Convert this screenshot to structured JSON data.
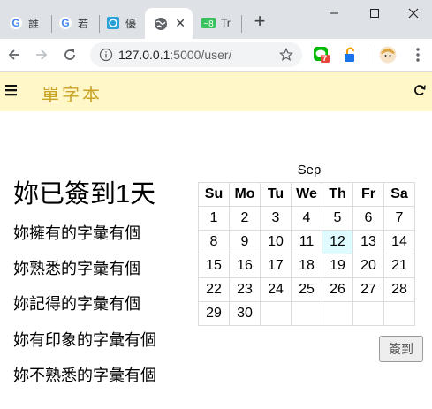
{
  "browser": {
    "tabs": [
      {
        "title": "誰",
        "icon": "google-icon"
      },
      {
        "title": "若",
        "icon": "google-icon"
      },
      {
        "title": "優",
        "icon": "site-icon"
      },
      {
        "title": "",
        "icon": "globe-icon",
        "active": true
      },
      {
        "title": "Tr",
        "icon": "translate-icon"
      }
    ],
    "new_tab": "+",
    "url_host": "127.0.0.1",
    "url_path": ":5000/user/",
    "extension_badge": "7"
  },
  "app": {
    "brand": "單字本",
    "menu_icon": "hamburger-menu-icon",
    "right_icon": "refresh-icon"
  },
  "main": {
    "title": "妳已簽到1天",
    "stats": [
      "妳擁有的字彙有個",
      "妳熟悉的字彙有個",
      "妳記得的字彙有個",
      "妳有印象的字彙有個",
      "妳不熟悉的字彙有個"
    ]
  },
  "calendar": {
    "month": "Sep",
    "weekdays": [
      "Su",
      "Mo",
      "Tu",
      "We",
      "Th",
      "Fr",
      "Sa"
    ],
    "weeks": [
      [
        "1",
        "2",
        "3",
        "4",
        "5",
        "6",
        "7"
      ],
      [
        "8",
        "9",
        "10",
        "11",
        "12",
        "13",
        "14"
      ],
      [
        "15",
        "16",
        "17",
        "18",
        "19",
        "20",
        "21"
      ],
      [
        "22",
        "23",
        "24",
        "25",
        "26",
        "27",
        "28"
      ],
      [
        "29",
        "30",
        "",
        "",
        "",
        "",
        ""
      ]
    ],
    "highlighted_day": "12",
    "highlight_color": "#e0fbff"
  },
  "signin_button": "簽到"
}
